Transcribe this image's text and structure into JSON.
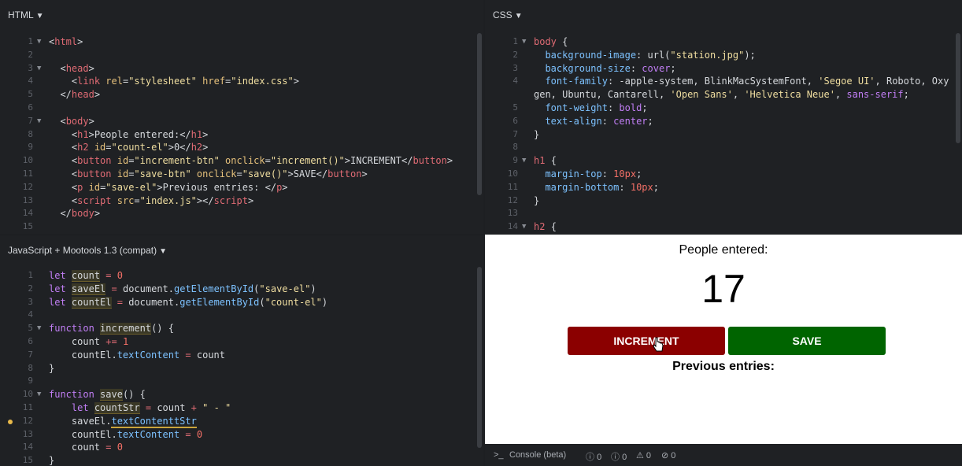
{
  "html_pane": {
    "title": "HTML",
    "lines": [
      {
        "n": "1",
        "fold": "▼",
        "html": "<span class='p'>&lt;</span><span class='t'>html</span><span class='p'>&gt;</span>"
      },
      {
        "n": "2",
        "fold": "",
        "html": ""
      },
      {
        "n": "3",
        "fold": "▼",
        "html": "  <span class='p'>&lt;</span><span class='t'>head</span><span class='p'>&gt;</span>"
      },
      {
        "n": "4",
        "fold": "",
        "html": "    <span class='p'>&lt;</span><span class='t'>link</span> <span class='a'>rel</span><span class='p'>=</span><span class='s'>\"stylesheet\"</span> <span class='a'>href</span><span class='p'>=</span><span class='s'>\"index.css\"</span><span class='p'>&gt;</span>"
      },
      {
        "n": "5",
        "fold": "",
        "html": "  <span class='p'>&lt;/</span><span class='t'>head</span><span class='p'>&gt;</span>"
      },
      {
        "n": "6",
        "fold": "",
        "html": ""
      },
      {
        "n": "7",
        "fold": "▼",
        "html": "  <span class='p'>&lt;</span><span class='t'>body</span><span class='p'>&gt;</span>"
      },
      {
        "n": "8",
        "fold": "",
        "html": "    <span class='p'>&lt;</span><span class='t'>h1</span><span class='p'>&gt;</span>People entered:<span class='p'>&lt;/</span><span class='t'>h1</span><span class='p'>&gt;</span>"
      },
      {
        "n": "9",
        "fold": "",
        "html": "    <span class='p'>&lt;</span><span class='t'>h2</span> <span class='a'>id</span><span class='p'>=</span><span class='s'>\"count-el\"</span><span class='p'>&gt;</span>0<span class='p'>&lt;/</span><span class='t'>h2</span><span class='p'>&gt;</span>"
      },
      {
        "n": "10",
        "fold": "",
        "html": "    <span class='p'>&lt;</span><span class='t'>button</span> <span class='a'>id</span><span class='p'>=</span><span class='s'>\"increment-btn\"</span> <span class='a'>onclick</span><span class='p'>=</span><span class='s'>\"increment()\"</span><span class='p'>&gt;</span>INCREMENT<span class='p'>&lt;/</span><span class='t'>button</span><span class='p'>&gt;</span>"
      },
      {
        "n": "11",
        "fold": "",
        "html": "    <span class='p'>&lt;</span><span class='t'>button</span> <span class='a'>id</span><span class='p'>=</span><span class='s'>\"save-btn\"</span> <span class='a'>onclick</span><span class='p'>=</span><span class='s'>\"save()\"</span><span class='p'>&gt;</span>SAVE<span class='p'>&lt;/</span><span class='t'>button</span><span class='p'>&gt;</span>"
      },
      {
        "n": "12",
        "fold": "",
        "html": "    <span class='p'>&lt;</span><span class='t'>p</span> <span class='a'>id</span><span class='p'>=</span><span class='s'>\"save-el\"</span><span class='p'>&gt;</span>Previous entries: <span class='p'>&lt;/</span><span class='t'>p</span><span class='p'>&gt;</span>"
      },
      {
        "n": "13",
        "fold": "",
        "html": "    <span class='p'>&lt;</span><span class='t'>script</span> <span class='a'>src</span><span class='p'>=</span><span class='s'>\"index.js\"</span><span class='p'>&gt;&lt;/</span><span class='t'>script</span><span class='p'>&gt;</span>"
      },
      {
        "n": "14",
        "fold": "",
        "html": "  <span class='p'>&lt;/</span><span class='t'>body</span><span class='p'>&gt;</span>"
      },
      {
        "n": "15",
        "fold": "",
        "html": ""
      }
    ]
  },
  "css_pane": {
    "title": "CSS",
    "lines": [
      {
        "n": "1",
        "fold": "▼",
        "html": "<span class='t'>body</span> <span class='p'>{</span>"
      },
      {
        "n": "2",
        "fold": "",
        "html": "  <span class='m'>background-image</span><span class='p'>:</span> url(<span class='s'>\"station.jpg\"</span>);"
      },
      {
        "n": "3",
        "fold": "",
        "html": "  <span class='m'>background-size</span><span class='p'>:</span> <span class='k'>cover</span>;"
      },
      {
        "n": "4",
        "fold": "",
        "html": "  <span class='m'>font-family</span><span class='p'>:</span> -apple-system, BlinkMacSystemFont, <span class='s'>'Segoe UI'</span>, Roboto, Oxy"
      },
      {
        "n": "",
        "fold": "",
        "html": "gen, Ubuntu, Cantarell, <span class='s'>'Open Sans'</span>, <span class='s'>'Helvetica Neue'</span>, <span class='k'>sans-serif</span>;"
      },
      {
        "n": "5",
        "fold": "",
        "html": "  <span class='m'>font-weight</span><span class='p'>:</span> <span class='k'>bold</span>;"
      },
      {
        "n": "6",
        "fold": "",
        "html": "  <span class='m'>text-align</span><span class='p'>:</span> <span class='k'>center</span>;"
      },
      {
        "n": "7",
        "fold": "",
        "html": "<span class='p'>}</span>"
      },
      {
        "n": "8",
        "fold": "",
        "html": ""
      },
      {
        "n": "9",
        "fold": "▼",
        "html": "<span class='t'>h1</span> <span class='p'>{</span>"
      },
      {
        "n": "10",
        "fold": "",
        "html": "  <span class='m'>margin-top</span><span class='p'>:</span> <span class='n'>10px</span>;"
      },
      {
        "n": "11",
        "fold": "",
        "html": "  <span class='m'>margin-bottom</span><span class='p'>:</span> <span class='n'>10px</span>;"
      },
      {
        "n": "12",
        "fold": "",
        "html": "<span class='p'>}</span>"
      },
      {
        "n": "13",
        "fold": "",
        "html": ""
      },
      {
        "n": "14",
        "fold": "▼",
        "html": "<span class='t'>h2</span> <span class='p'>{</span>"
      }
    ]
  },
  "js_pane": {
    "title": "JavaScript + Mootools 1.3 (compat)",
    "lines": [
      {
        "n": "1",
        "fold": "",
        "html": "<span class='kw'>let</span> <span class='hl'>count</span> <span class='op'>=</span> <span class='n'>0</span>"
      },
      {
        "n": "2",
        "fold": "",
        "html": "<span class='kw'>let</span> <span class='hl'>saveEl</span> <span class='op'>=</span> document.<span class='m'>getElementById</span>(<span class='s'>\"save-el\"</span>)"
      },
      {
        "n": "3",
        "fold": "",
        "html": "<span class='kw'>let</span> <span class='hl'>countEl</span> <span class='op'>=</span> document.<span class='m'>getElementById</span>(<span class='s'>\"count-el\"</span>)"
      },
      {
        "n": "4",
        "fold": "",
        "html": ""
      },
      {
        "n": "5",
        "fold": "▼",
        "html": "<span class='kw'>function</span> <span class='hl'>increment</span>() {"
      },
      {
        "n": "6",
        "fold": "",
        "html": "    count <span class='op'>+=</span> <span class='n'>1</span>"
      },
      {
        "n": "7",
        "fold": "",
        "html": "    countEl.<span class='m'>textContent</span> <span class='op'>=</span> count"
      },
      {
        "n": "8",
        "fold": "",
        "html": "}"
      },
      {
        "n": "9",
        "fold": "",
        "html": ""
      },
      {
        "n": "10",
        "fold": "▼",
        "html": "<span class='kw'>function</span> <span class='hl'>save</span>() {"
      },
      {
        "n": "11",
        "fold": "",
        "html": "    <span class='kw'>let</span> <span class='hl'>countStr</span> <span class='op'>=</span> count <span class='op'>+</span> <span class='s'>\" - \"</span>"
      },
      {
        "n": "12",
        "fold": "",
        "dot": true,
        "html": "    saveEl.<span class='m hl2'>textContenttStr</span>"
      },
      {
        "n": "13",
        "fold": "",
        "html": "    countEl.<span class='m'>textContent</span> <span class='op'>=</span> <span class='n'>0</span>"
      },
      {
        "n": "14",
        "fold": "",
        "html": "    count <span class='op'>=</span> <span class='n'>0</span>"
      },
      {
        "n": "15",
        "fold": "",
        "html": "}"
      }
    ]
  },
  "preview": {
    "heading": "People entered:",
    "count": "17",
    "increment_label": "INCREMENT",
    "save_label": "SAVE",
    "entries_label": "Previous entries:",
    "increment_color": "#8b0000",
    "save_color": "#006400"
  },
  "console": {
    "label": "Console (beta)",
    "counts": [
      "0",
      "0",
      "0",
      "0"
    ]
  }
}
